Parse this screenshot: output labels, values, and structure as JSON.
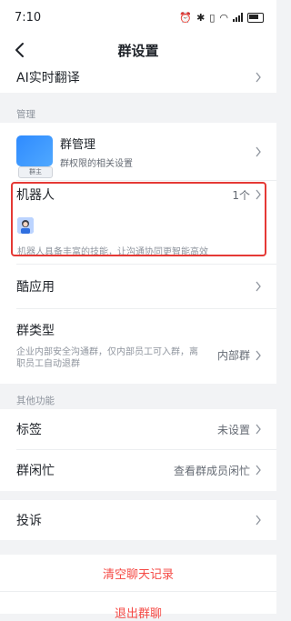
{
  "status": {
    "time": "7:10"
  },
  "header": {
    "title": "群设置"
  },
  "rows": {
    "ai_translate": {
      "label": "AI实时翻译"
    },
    "group_manage": {
      "title": "群管理",
      "subtitle": "群权限的相关设置",
      "owner_badge": "群主"
    },
    "robot": {
      "label": "机器人",
      "count": "1个",
      "hint": "机器人具备丰富的技能，让沟通协同更智能高效"
    },
    "cool_apps": {
      "label": "酷应用"
    },
    "group_type": {
      "label": "群类型",
      "value": "内部群",
      "desc": "企业内部安全沟通群，仅内部员工可入群，离职员工自动退群"
    },
    "tag": {
      "label": "标签",
      "value": "未设置"
    },
    "idle": {
      "label": "群闲忙",
      "value": "查看群成员闲忙"
    },
    "report": {
      "label": "投诉"
    }
  },
  "sections": {
    "manage": "管理",
    "other": "其他功能"
  },
  "actions": {
    "clear_history": "清空聊天记录",
    "leave_group": "退出群聊"
  },
  "colors": {
    "accent_red": "#f54a45",
    "highlight_border": "#e53935",
    "brand_blue": "#3370ff"
  }
}
